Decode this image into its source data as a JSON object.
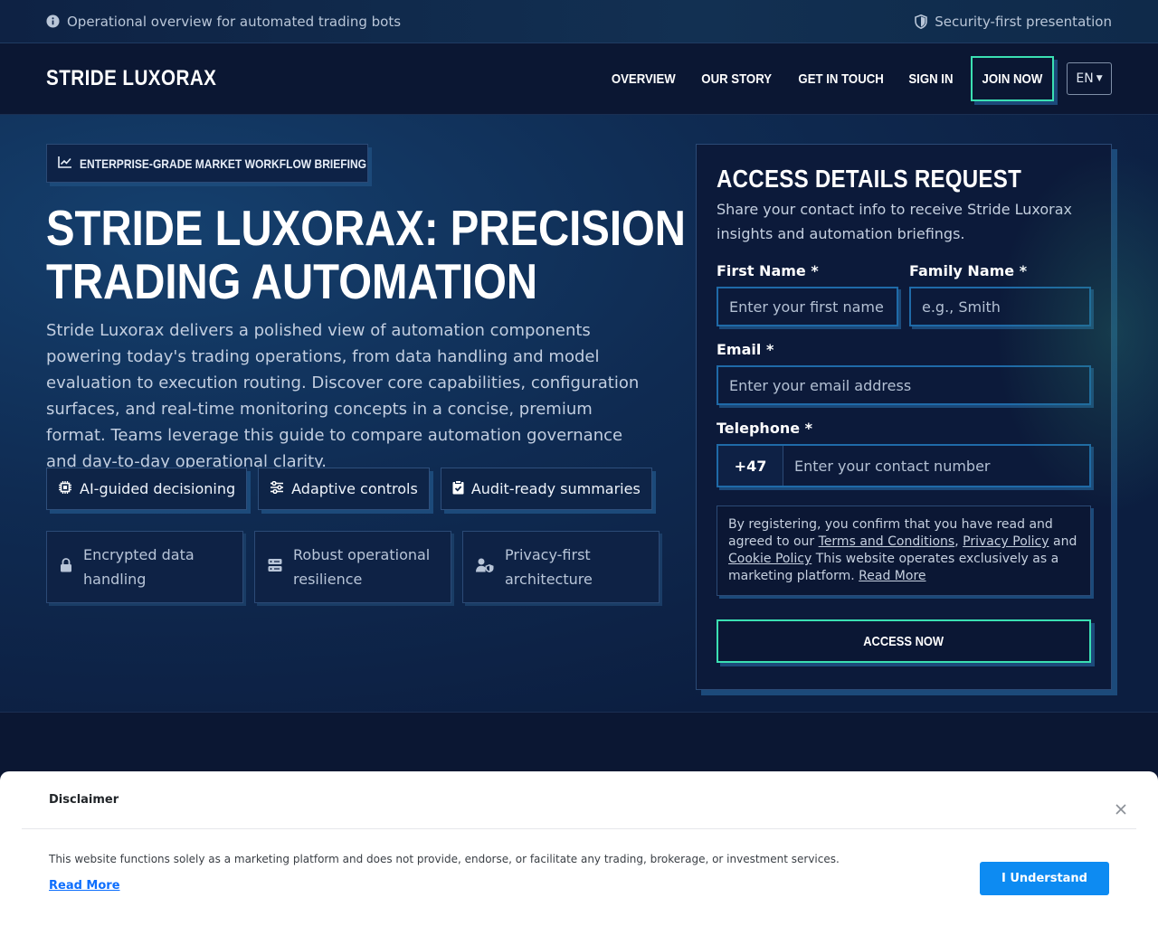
{
  "infobar": {
    "left_text": "Operational overview for automated trading bots",
    "right_text": "Security-first presentation"
  },
  "header": {
    "logo": "STRIDE LUXORAX",
    "nav": [
      "OVERVIEW",
      "OUR STORY",
      "GET IN TOUCH",
      "SIGN IN"
    ],
    "join_label": "JOIN NOW",
    "lang": "EN"
  },
  "hero": {
    "eyebrow": "ENTERPRISE-GRADE MARKET WORKFLOW BRIEFING",
    "title_line1": "STRIDE LUXORAX: PRECISION",
    "title_line2": "TRADING AUTOMATION",
    "description": "Stride Luxorax delivers a polished view of automation components powering today's trading operations, from data handling and model evaluation to exe­cution routing. Discover core capabilities, configuration surfaces, and real-time monitoring concepts in a concise, premium format. Teams leverage this guide to compare automation governance and day-to-day operational clarity.",
    "chips": [
      "AI-guided decisioning",
      "Adaptive controls",
      "Audit-ready summaries"
    ],
    "cards": [
      "Encrypted data handling",
      "Robust operational resilience",
      "Privacy-first architecture"
    ]
  },
  "form": {
    "title": "ACCESS DETAILS REQUEST",
    "subtitle": "Share your contact info to receive Stride Luxorax insights and automation briefings.",
    "first_name_label": "First Name *",
    "first_name_placeholder": "Enter your first name",
    "family_name_label": "Family Name *",
    "family_name_placeholder": "e.g., Smith",
    "email_label": "Email *",
    "email_placeholder": "Enter your email address",
    "telephone_label": "Telephone *",
    "country_code": "+47",
    "telephone_placeholder": "Enter your contact number",
    "consent_prefix": "By registering, you confirm that you have read and agreed to our ",
    "terms_link": "Terms and Conditions",
    "comma": ", ",
    "privacy_link": "Privacy Policy",
    "and": " and ",
    "cookie_link": "Cookie Policy",
    "consent_suffix": " This website operates exclusively as a marketing platform. ",
    "read_more": "Read More",
    "submit_label": "ACCESS NOW"
  },
  "disclaimer": {
    "title": "Disclaimer",
    "text": "This website functions solely as a marketing platform and does not provide, endorse, or facilitate any trading, brokerage, or investment services.",
    "read_more": "Read More",
    "button": "I Understand"
  },
  "colors": {
    "accent_green": "#3be0b2",
    "primary_blue": "#0d8bf2",
    "bg_navy": "#0b1733"
  }
}
